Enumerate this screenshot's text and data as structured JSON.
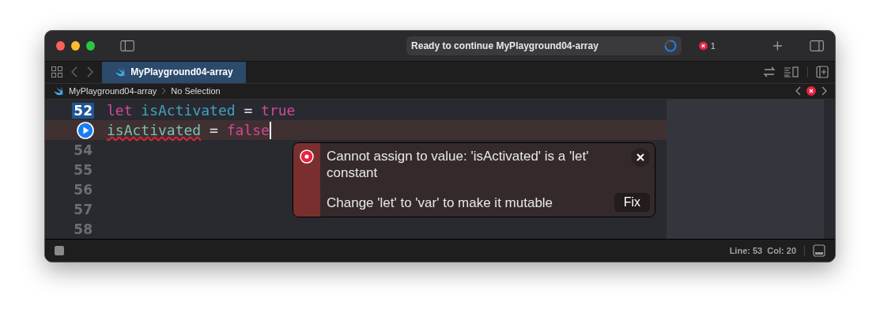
{
  "window": {
    "title_status": "Ready to continue MyPlayground04-array",
    "error_count": "1"
  },
  "tabs": [
    {
      "label": "MyPlayground04-array",
      "selected": true
    }
  ],
  "breadcrumb": [
    "MyPlayground04-array",
    "No Selection"
  ],
  "lines": [
    {
      "kind": "number",
      "number": "52",
      "highlighted": true,
      "error": false,
      "tokens": [
        {
          "kind": "keyword",
          "text": "let "
        },
        {
          "kind": "identifier",
          "text": "isActivated"
        },
        {
          "kind": "plain",
          "text": " = "
        },
        {
          "kind": "keyword",
          "text": "true"
        }
      ]
    },
    {
      "kind": "run",
      "error": true,
      "tokens": [
        {
          "kind": "variable",
          "text": "isActivated"
        },
        {
          "kind": "plain",
          "text": " = "
        },
        {
          "kind": "keyword",
          "text": "false"
        }
      ]
    },
    {
      "kind": "number",
      "number": "54",
      "highlighted": false,
      "error": false
    },
    {
      "kind": "number",
      "number": "55",
      "highlighted": false,
      "error": false
    },
    {
      "kind": "number",
      "number": "56",
      "highlighted": false,
      "error": false
    },
    {
      "kind": "number",
      "number": "57",
      "highlighted": false,
      "error": false
    },
    {
      "kind": "number",
      "number": "58",
      "highlighted": false,
      "error": false
    }
  ],
  "error_popup": {
    "message": "Cannot assign to value: 'isActivated' is a 'let' constant",
    "fix_message": "Change 'let' to 'var' to make it mutable",
    "fix_button": "Fix"
  },
  "status_bar": {
    "position": "Line: 53  Col: 20"
  }
}
